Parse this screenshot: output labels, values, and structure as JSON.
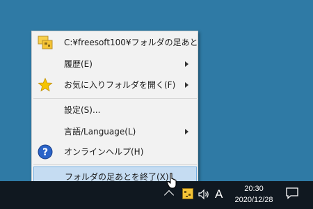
{
  "menu": {
    "items": [
      {
        "label": "C:¥freesoft100¥フォルダの足あと",
        "icon": "folder-app-icon",
        "submenu": false
      },
      {
        "label": "履歴(E)",
        "icon": null,
        "submenu": true
      },
      {
        "label": "お気に入りフォルダを開く(F)",
        "icon": "star-icon",
        "submenu": true
      },
      {
        "label": "設定(S)...",
        "icon": null,
        "submenu": false
      },
      {
        "label": "言語/Language(L)",
        "icon": null,
        "submenu": true
      },
      {
        "label": "オンラインヘルプ(H)",
        "icon": "help-icon",
        "submenu": false
      },
      {
        "label": "フォルダの足あとを終了(X)",
        "icon": null,
        "submenu": false,
        "highlighted": true
      }
    ]
  },
  "taskbar": {
    "ime": "A",
    "time": "20:30",
    "date": "2020/12/28"
  },
  "colors": {
    "desktop": "#2f7aa5",
    "taskbar": "#101820",
    "highlight": "#c5dcf2",
    "highlight_border": "#77b0e3"
  }
}
